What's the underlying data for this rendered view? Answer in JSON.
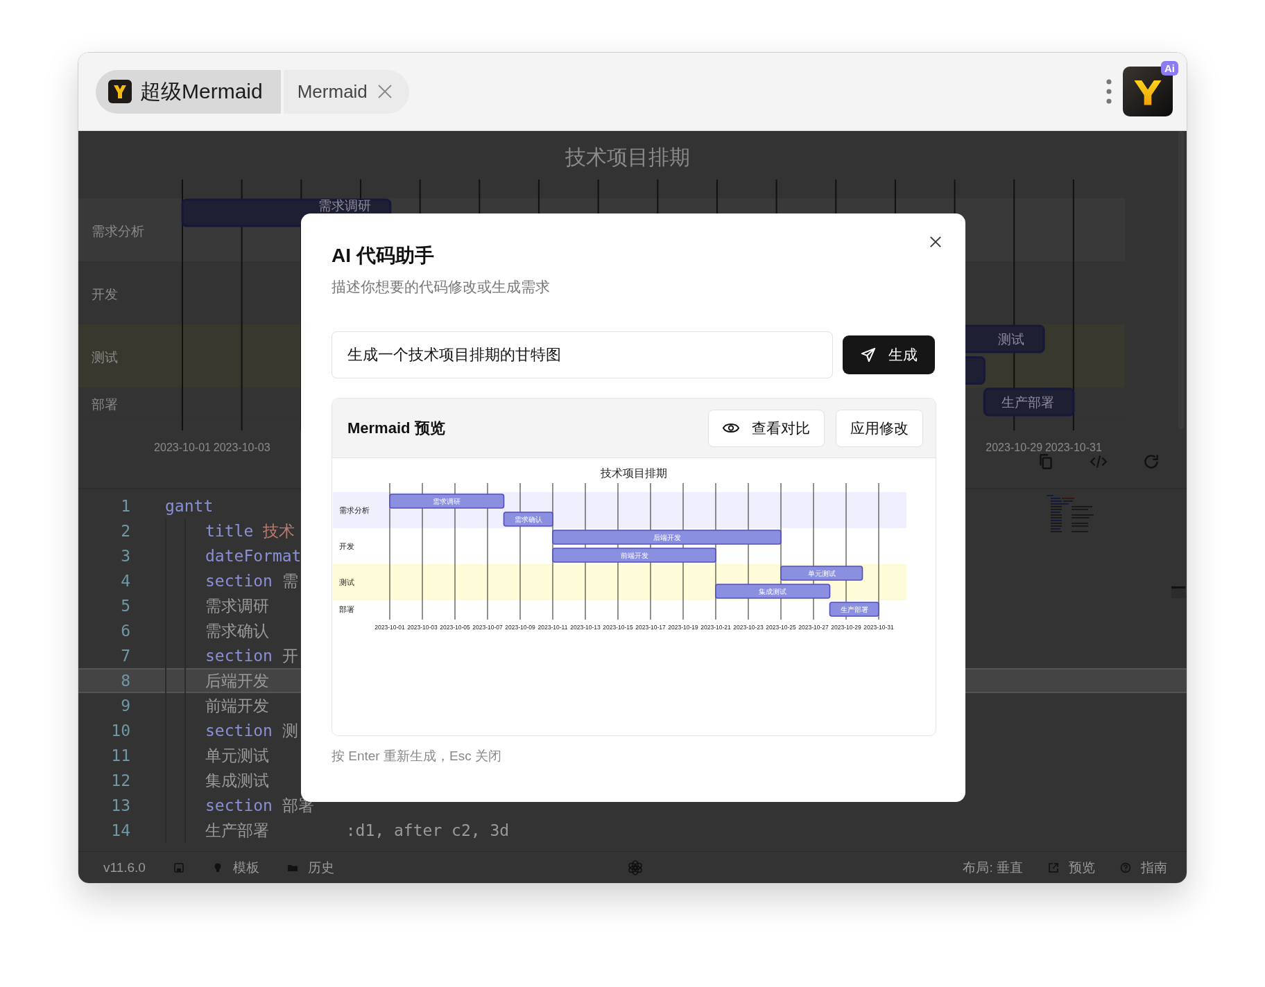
{
  "titlebar": {
    "app_tab": {
      "label": "超级Mermaid",
      "selected": true
    },
    "doc_tab": {
      "label": "Mermaid",
      "selected": false
    },
    "ai_badge": "Ai"
  },
  "background_chart": {
    "title": "技术项目排期",
    "sections": [
      "需求分析",
      "开发",
      "测试",
      "部署"
    ],
    "bar_labels": [
      "需求调研",
      "测试",
      "生产部署"
    ],
    "axis_start": [
      "2023-10-01",
      "2023-10-03"
    ],
    "axis_end": [
      "2023-10-29",
      "2023-10-31"
    ]
  },
  "editor": {
    "lines": [
      {
        "number": "1",
        "current": false,
        "parts": [
          {
            "kind": "keyword",
            "text": "gantt"
          }
        ],
        "children": [
          {
            "number": "2",
            "current": false,
            "parts": [
              {
                "kind": "keyword",
                "text": "title"
              },
              {
                "kind": "string",
                "text": "技术"
              }
            ]
          },
          {
            "number": "3",
            "current": false,
            "parts": [
              {
                "kind": "keyword",
                "text": "dateFormat"
              }
            ]
          },
          {
            "number": "4",
            "current": false,
            "parts": [
              {
                "kind": "keyword",
                "text": "section"
              },
              {
                "kind": "text",
                "text": "需"
              }
            ]
          },
          {
            "number": "5",
            "current": false,
            "parts": [
              {
                "kind": "text",
                "text": "需求调研"
              }
            ]
          },
          {
            "number": "6",
            "current": false,
            "parts": [
              {
                "kind": "text",
                "text": "需求确认"
              }
            ]
          },
          {
            "number": "7",
            "current": false,
            "parts": [
              {
                "kind": "keyword",
                "text": "section"
              },
              {
                "kind": "text",
                "text": "开"
              }
            ]
          },
          {
            "number": "8",
            "current": true,
            "parts": [
              {
                "kind": "text",
                "text": "后端开发"
              }
            ]
          },
          {
            "number": "9",
            "current": false,
            "parts": [
              {
                "kind": "text",
                "text": "前端开发"
              }
            ]
          },
          {
            "number": "10",
            "current": false,
            "parts": [
              {
                "kind": "keyword",
                "text": "section"
              },
              {
                "kind": "text",
                "text": "测"
              }
            ]
          },
          {
            "number": "11",
            "current": false,
            "parts": [
              {
                "kind": "text",
                "text": "单元测试"
              }
            ]
          },
          {
            "number": "12",
            "current": false,
            "parts": [
              {
                "kind": "text",
                "text": "集成测试"
              }
            ]
          },
          {
            "number": "13",
            "current": false,
            "parts": [
              {
                "kind": "keyword",
                "text": "section"
              },
              {
                "kind": "text",
                "text": "部署"
              }
            ]
          },
          {
            "number": "14",
            "current": false,
            "parts": [
              {
                "kind": "text",
                "text": "生产部署        :d1, after c2, 3d"
              }
            ]
          }
        ]
      }
    ]
  },
  "status_bar": {
    "version": "v11.6.0",
    "left_links": [
      "模板",
      "历史"
    ],
    "layout": "布局: 垂直",
    "right_links": [
      "预览",
      "指南"
    ]
  },
  "modal": {
    "title": "AI 代码助手",
    "subtitle": "描述你想要的代码修改或生成需求",
    "prompt": {
      "value": "生成一个技术项目排期的甘特图"
    },
    "generate_button": "生成",
    "preview": {
      "title": "Mermaid 预览",
      "compare_button": "查看对比",
      "apply_button": "应用修改",
      "chart": {
        "title": "技术项目排期",
        "sections": [
          {
            "name": "需求分析",
            "tasks": [
              "需求调研",
              "需求确认"
            ]
          },
          {
            "name": "开发",
            "tasks": [
              "后端开发",
              "前端开发"
            ]
          },
          {
            "name": "测试",
            "tasks": [
              "单元测试",
              "集成测试"
            ]
          },
          {
            "name": "部署",
            "tasks": [
              "生产部署"
            ]
          }
        ],
        "ticks": [
          "2023-10-01",
          "2023-10-03",
          "2023-10-05",
          "2023-10-07",
          "2023-10-09",
          "2023-10-11",
          "2023-10-13",
          "2023-10-15",
          "2023-10-17",
          "2023-10-19",
          "2023-10-21",
          "2023-10-23",
          "2023-10-25",
          "2023-10-27",
          "2023-10-29",
          "2023-10-31"
        ]
      }
    },
    "hint": "按 Enter 重新生成，Esc 关闭"
  }
}
